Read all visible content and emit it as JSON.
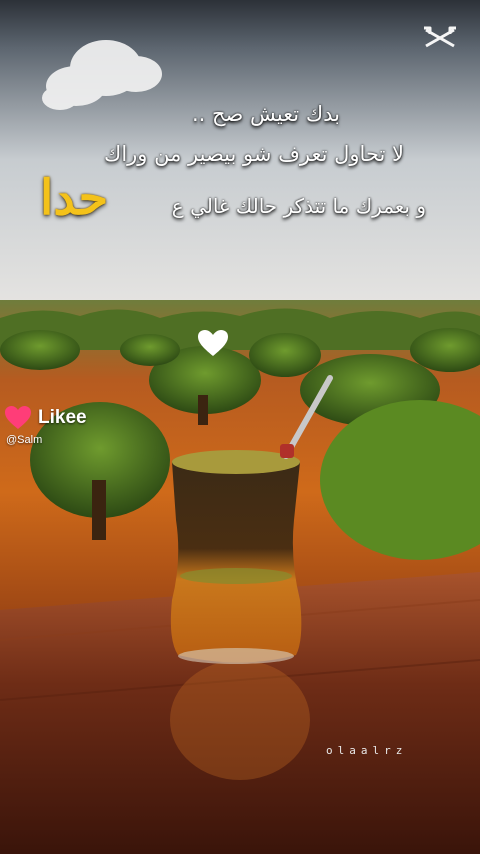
{
  "top_icons": {
    "app_logo_icon": "capcut-logo-icon"
  },
  "caption": {
    "line1": "بدك تعيش صح ..",
    "line2": "لا تحاول تعرف شو بيصير من وراك",
    "line3": "و بعمرك ما تتذكر حالك غالي ع",
    "highlight": "حدا"
  },
  "likee": {
    "brand": "Likee",
    "user": "@Salm"
  },
  "overlay_icons": {
    "heart": "heart-icon"
  },
  "watermark": "olaalrz",
  "colors": {
    "highlight_gold": "#f4c21a",
    "sky": "#d9dde0",
    "table_wood": "#7a3a1a",
    "likee_pink": "#ff3d78"
  }
}
